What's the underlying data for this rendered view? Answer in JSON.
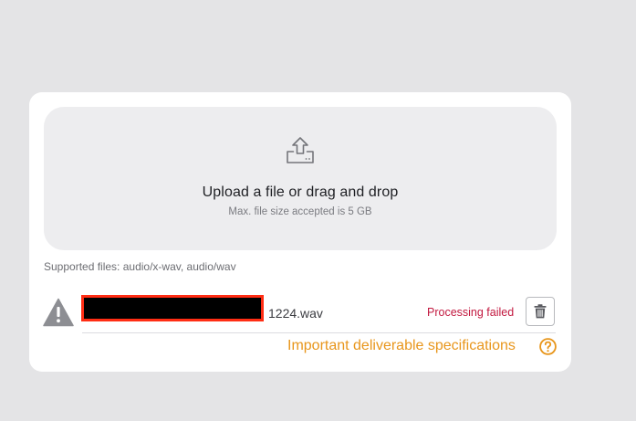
{
  "upload": {
    "icon": "upload-tray-icon",
    "title": "Upload a file or drag and drop",
    "subtitle": "Max. file size accepted is 5 GB"
  },
  "supported_files": "Supported files: audio/x-wav, audio/wav",
  "file_row": {
    "warning_icon": "warning-triangle-icon",
    "filename_redacted": true,
    "filename_suffix": "1224.wav",
    "status": "Processing failed",
    "delete_icon": "trash-icon"
  },
  "spec_link": {
    "label": "Important deliverable specifications",
    "icon": "question-circle-icon"
  },
  "colors": {
    "background": "#e4e4e6",
    "card": "#ffffff",
    "dropzone": "#ededef",
    "status_error": "#c2183f",
    "link_accent": "#e8961c",
    "redaction_border": "#ff2d14"
  }
}
